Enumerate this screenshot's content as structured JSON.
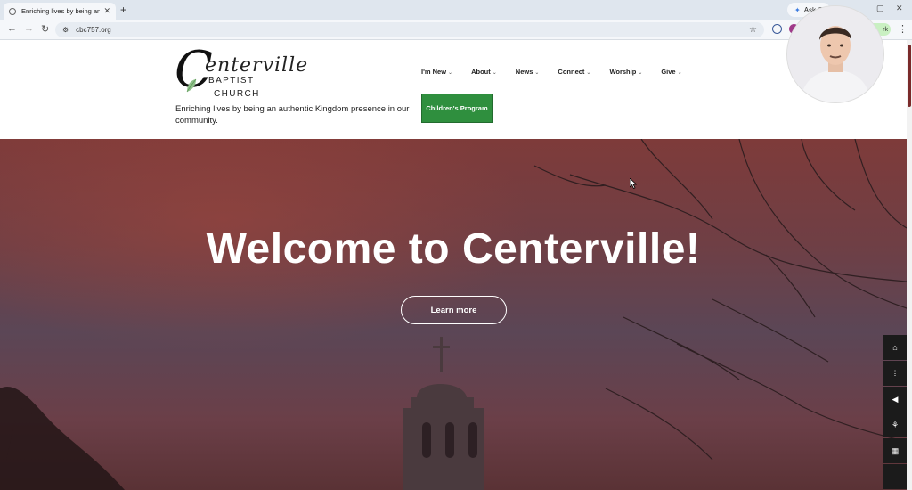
{
  "browser": {
    "tab_title": "Enriching lives by being an au...",
    "tab_close": "✕",
    "new_tab": "+",
    "ask_label": "Ask G",
    "url": "cbc757.org",
    "work_label": "rk"
  },
  "header": {
    "logo_script": "enterville",
    "logo_big_c": "C",
    "logo_line1": "BAPTIST",
    "logo_line2": "CHURCH",
    "tagline": "Enriching lives by being an authentic Kingdom presence in our community.",
    "nav": [
      {
        "label": "I'm New"
      },
      {
        "label": "About"
      },
      {
        "label": "News"
      },
      {
        "label": "Connect"
      },
      {
        "label": "Worship"
      },
      {
        "label": "Give"
      }
    ],
    "cta_label": "Children's Program"
  },
  "hero": {
    "title": "Welcome to Centerville!",
    "button_label": "Learn more"
  },
  "sidebar_icons": [
    "home-icon",
    "footprints-icon",
    "megaphone-icon",
    "hands-icon",
    "calendar-icon"
  ],
  "colors": {
    "accent_green": "#2f8f3e",
    "hero_red": "#7e3b3a",
    "sidebar_bg": "#1b1b1b"
  }
}
